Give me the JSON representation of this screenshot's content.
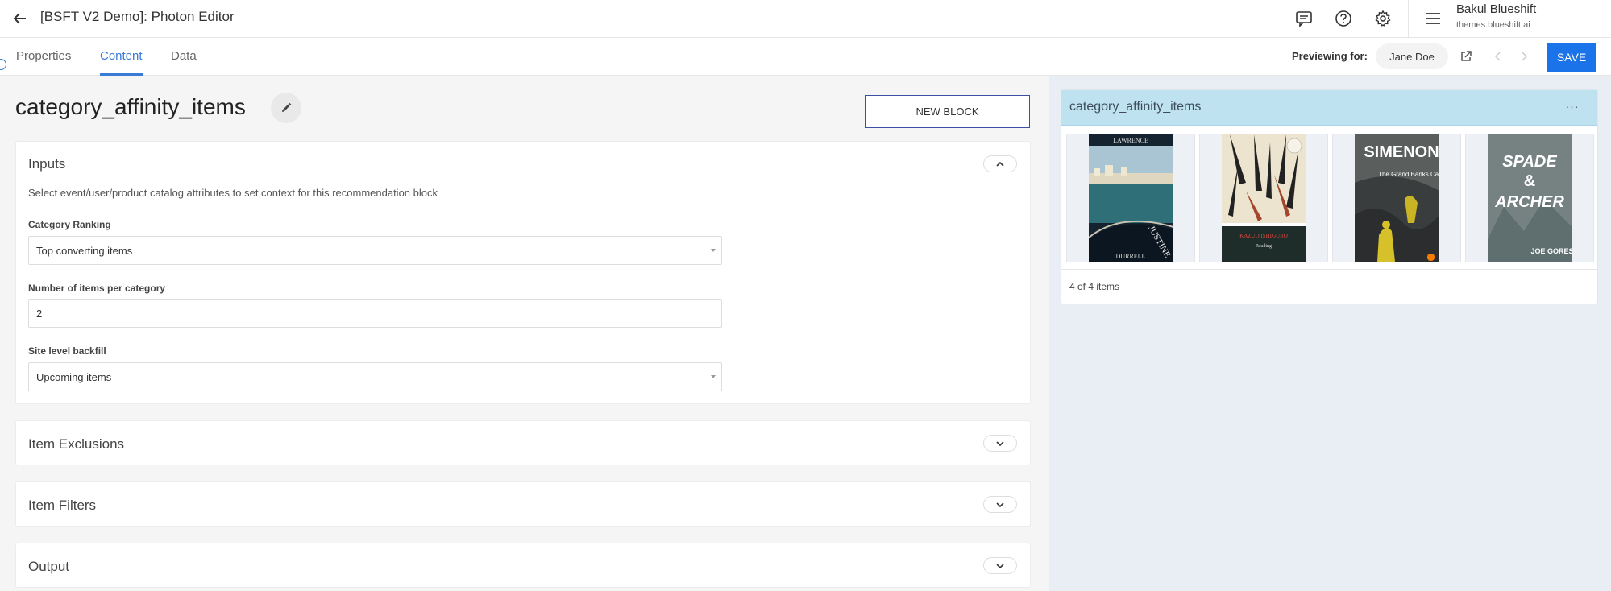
{
  "header": {
    "title": "[BSFT V2 Demo]: Photon Editor",
    "user_name": "Bakul Blueshift",
    "user_domain": "themes.blueshift.ai"
  },
  "tabs": [
    {
      "label": "Properties",
      "active": false
    },
    {
      "label": "Content",
      "active": true
    },
    {
      "label": "Data",
      "active": false
    }
  ],
  "preview": {
    "label": "Previewing for:",
    "user": "Jane Doe",
    "save_label": "SAVE"
  },
  "block": {
    "title": "category_affinity_items",
    "new_block_label": "NEW BLOCK"
  },
  "inputs": {
    "title": "Inputs",
    "description": "Select event/user/product catalog attributes to set context for this recommendation block",
    "category_ranking": {
      "label": "Category Ranking",
      "value": "Top converting items"
    },
    "items_per_category": {
      "label": "Number of items per category",
      "value": "2"
    },
    "site_backfill": {
      "label": "Site level backfill",
      "value": "Upcoming items"
    }
  },
  "sections": [
    {
      "title": "Item Exclusions"
    },
    {
      "title": "Item Filters"
    },
    {
      "title": "Output"
    }
  ],
  "preview_block": {
    "title": "category_affinity_items",
    "more": "···",
    "count": "4 of 4 items",
    "books": [
      {
        "name": "justine",
        "top": "LAWRENCE",
        "spine": "JUSTINE",
        "bottom": "DURRELL"
      },
      {
        "name": "nocturnes",
        "text": "Reading"
      },
      {
        "name": "grand-banks-cafe",
        "author": "SIMENON",
        "subtitle": "The Grand Banks Café"
      },
      {
        "name": "spade-archer",
        "line1": "SPADE",
        "line2": "&",
        "line3": "ARCHER",
        "author": "JOE GORES"
      }
    ]
  },
  "colors": {
    "accent": "#3a7bd5",
    "save": "#1a73e8",
    "preview_header": "#bfe2f1"
  }
}
